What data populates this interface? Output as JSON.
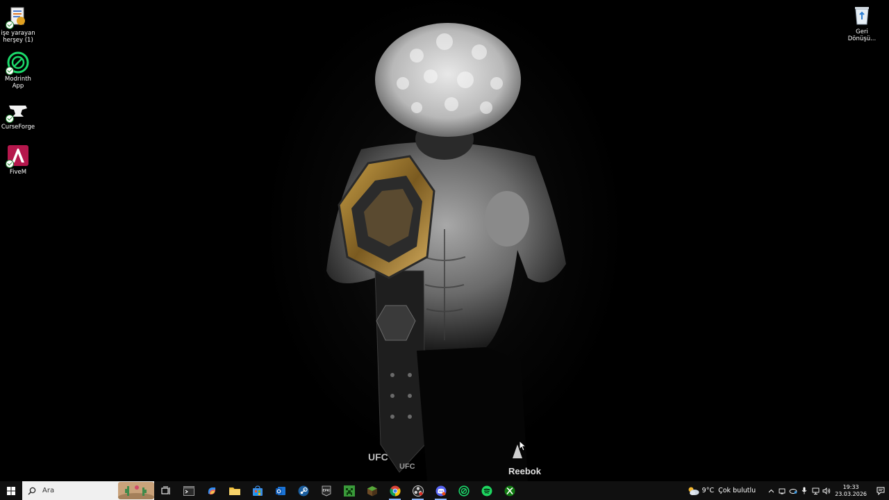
{
  "desktop": {
    "icons": [
      {
        "label": "işe yarayan herşey (1)",
        "icon": "document-folder-icon"
      },
      {
        "label": "Modrinth App",
        "icon": "modrinth-icon"
      },
      {
        "label": "CurseForge",
        "icon": "curseforge-anvil-icon"
      },
      {
        "label": "FiveM",
        "icon": "fivem-icon"
      }
    ],
    "recycle_bin": {
      "label": "Geri Dönüşü...",
      "icon": "recycle-bin-icon"
    },
    "wallpaper": {
      "belt_text": "UFC",
      "brand_text": "Reebok"
    }
  },
  "taskbar": {
    "search_placeholder": "Ara",
    "apps": [
      {
        "name": "task-view",
        "icon": "task-view-icon"
      },
      {
        "name": "terminal",
        "icon": "terminal-icon"
      },
      {
        "name": "copilot",
        "icon": "copilot-icon"
      },
      {
        "name": "file-explorer",
        "icon": "folder-icon"
      },
      {
        "name": "microsoft-store",
        "icon": "store-icon"
      },
      {
        "name": "outlook",
        "icon": "outlook-icon"
      },
      {
        "name": "steam",
        "icon": "steam-icon"
      },
      {
        "name": "epic-games",
        "icon": "epic-games-icon",
        "text": "EPIC"
      },
      {
        "name": "minecraft-launcher",
        "icon": "minecraft-icon"
      },
      {
        "name": "minecraft-edition",
        "icon": "minecraft-block-icon"
      },
      {
        "name": "chrome",
        "icon": "chrome-icon"
      },
      {
        "name": "obs",
        "icon": "obs-icon"
      },
      {
        "name": "discord-chrome",
        "icon": "discord-icon"
      },
      {
        "name": "modrinth",
        "icon": "modrinth-icon"
      },
      {
        "name": "spotify",
        "icon": "spotify-icon"
      },
      {
        "name": "xbox",
        "icon": "xbox-icon"
      }
    ],
    "weather": {
      "temp": "9°C",
      "condition": "Çok bulutlu"
    },
    "clock": {
      "time": "19:33",
      "date": "23.03.2026"
    }
  },
  "colors": {
    "taskbar_bg": "#101010",
    "search_bg": "#f0f0f0",
    "accent_green": "#1bd96a",
    "fivem_bg": "#b5174c"
  }
}
